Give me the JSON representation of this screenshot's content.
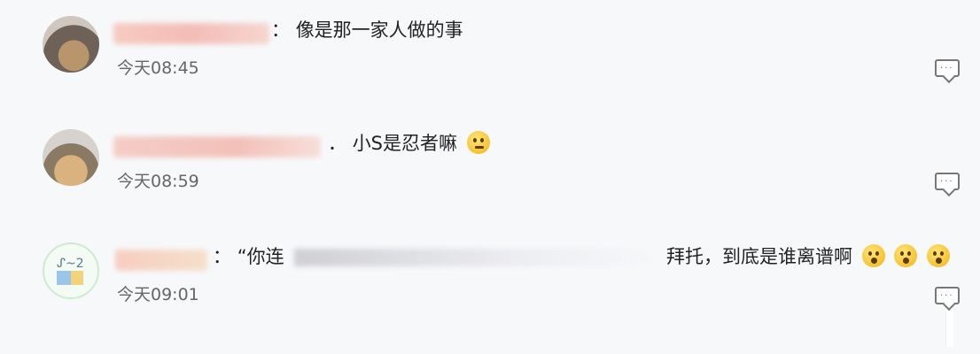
{
  "comments": [
    {
      "separator": "：",
      "text": "像是那一家人做的事",
      "time": "今天08:45"
    },
    {
      "separator": "．",
      "text": "小S是忍者嘛",
      "time": "今天08:59",
      "emoji": "smirk-emoji"
    },
    {
      "separator": "：",
      "text_start": "“你连",
      "text_end": "拜托，到底是谁离谱啊",
      "time": "今天09:01",
      "emojis": [
        "surprised-emoji",
        "surprised-emoji",
        "surprised-emoji"
      ]
    }
  ],
  "icons": {
    "reply": "comment-reply-icon"
  }
}
